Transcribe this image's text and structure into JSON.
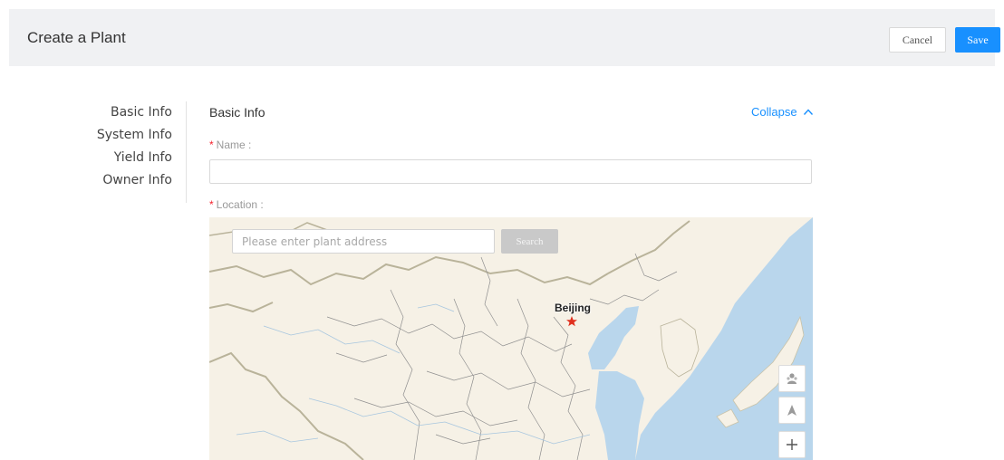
{
  "header": {
    "title": "Create a Plant",
    "cancel_label": "Cancel",
    "save_label": "Save"
  },
  "sidenav": {
    "items": [
      {
        "label": "Basic Info"
      },
      {
        "label": "System Info"
      },
      {
        "label": "Yield Info"
      },
      {
        "label": "Owner Info"
      }
    ]
  },
  "section": {
    "title": "Basic Info",
    "collapse_label": "Collapse"
  },
  "form": {
    "name_label": "Name :",
    "name_value": "",
    "location_label": "Location :",
    "required_marker": "*"
  },
  "map": {
    "search_placeholder": "Please enter plant address",
    "search_value": "",
    "search_button": "Search",
    "city_label": "Beijing",
    "colors": {
      "land": "#f6f1e6",
      "sea": "#b9d6ec",
      "border": "#b9b39a",
      "capital_star": "#e0301e"
    },
    "controls": [
      {
        "icon": "street-view-icon"
      },
      {
        "icon": "locate-arrow-icon"
      },
      {
        "icon": "zoom-in-icon"
      }
    ]
  },
  "colors": {
    "primary": "#1890ff",
    "header_bg": "#f0f1f3",
    "required": "#f5222d"
  }
}
